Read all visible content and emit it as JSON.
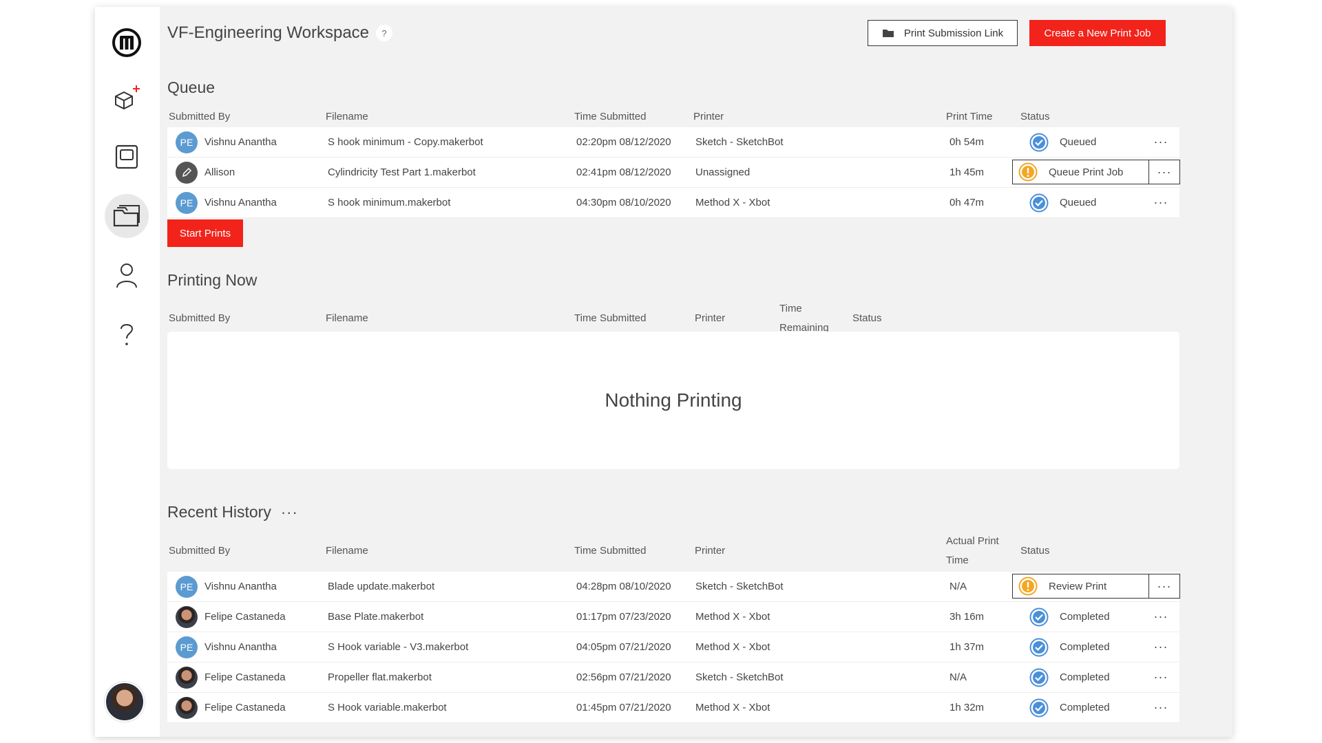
{
  "workspace": {
    "title": "VF-Engineering Workspace",
    "help": "?"
  },
  "actions": {
    "submission_link": "Print Submission Link",
    "create_job": "Create a New Print Job",
    "start_prints": "Start Prints"
  },
  "queue": {
    "title": "Queue",
    "headers": {
      "submitted_by": "Submitted By",
      "filename": "Filename",
      "time_submitted": "Time Submitted",
      "printer": "Printer",
      "print_time": "Print Time",
      "status": "Status"
    },
    "rows": [
      {
        "avatar": "PE",
        "user": "Vishnu Anantha",
        "file": "S hook minimum - Copy.makerbot",
        "time": "02:20pm 08/12/2020",
        "printer": "Sketch - SketchBot",
        "ptime": "0h 54m",
        "status": "Queued",
        "more": "···"
      },
      {
        "avatar": "",
        "user": "Allison",
        "file": "Cylindricity Test Part 1.makerbot",
        "time": "02:41pm 08/12/2020",
        "printer": "Unassigned",
        "ptime": "1h 45m",
        "status": "Queue Print Job",
        "more": "···"
      },
      {
        "avatar": "PE",
        "user": "Vishnu Anantha",
        "file": "S hook minimum.makerbot",
        "time": "04:30pm 08/10/2020",
        "printer": "Method X - Xbot",
        "ptime": "0h 47m",
        "status": "Queued",
        "more": "···"
      }
    ]
  },
  "printing_now": {
    "title": "Printing Now",
    "headers": {
      "submitted_by": "Submitted By",
      "filename": "Filename",
      "time_submitted": "Time Submitted",
      "printer": "Printer",
      "time_remaining_1": "Time",
      "time_remaining_2": "Remaining",
      "status": "Status"
    },
    "empty": "Nothing Printing"
  },
  "history": {
    "title": "Recent History",
    "menu": "···",
    "headers": {
      "submitted_by": "Submitted By",
      "filename": "Filename",
      "time_submitted": "Time Submitted",
      "printer": "Printer",
      "actual_1": "Actual Print",
      "actual_2": "Time",
      "status": "Status"
    },
    "rows": [
      {
        "avatar": "PE",
        "user": "Vishnu Anantha",
        "file": "Blade update.makerbot",
        "time": "04:28pm 08/10/2020",
        "printer": "Sketch - SketchBot",
        "ptime": "N/A",
        "status": "Review Print",
        "more": "···"
      },
      {
        "avatar": "",
        "user": "Felipe Castaneda",
        "file": "Base Plate.makerbot",
        "time": "01:17pm 07/23/2020",
        "printer": "Method X - Xbot",
        "ptime": "3h 16m",
        "status": "Completed",
        "more": "···"
      },
      {
        "avatar": "PE",
        "user": "Vishnu Anantha",
        "file": "S Hook variable - V3.makerbot",
        "time": "04:05pm 07/21/2020",
        "printer": "Method X - Xbot",
        "ptime": "1h 37m",
        "status": "Completed",
        "more": "···"
      },
      {
        "avatar": "",
        "user": "Felipe Castaneda",
        "file": "Propeller flat.makerbot",
        "time": "02:56pm 07/21/2020",
        "printer": "Sketch - SketchBot",
        "ptime": "N/A",
        "status": "Completed",
        "more": "···"
      },
      {
        "avatar": "",
        "user": "Felipe Castaneda",
        "file": "S Hook variable.makerbot",
        "time": "01:45pm 07/21/2020",
        "printer": "Method X - Xbot",
        "ptime": "1h 32m",
        "status": "Completed",
        "more": "···"
      }
    ]
  },
  "colors": {
    "accent_red": "#f2231b",
    "check_blue": "#4a90d9",
    "warn_orange": "#f5a623"
  }
}
